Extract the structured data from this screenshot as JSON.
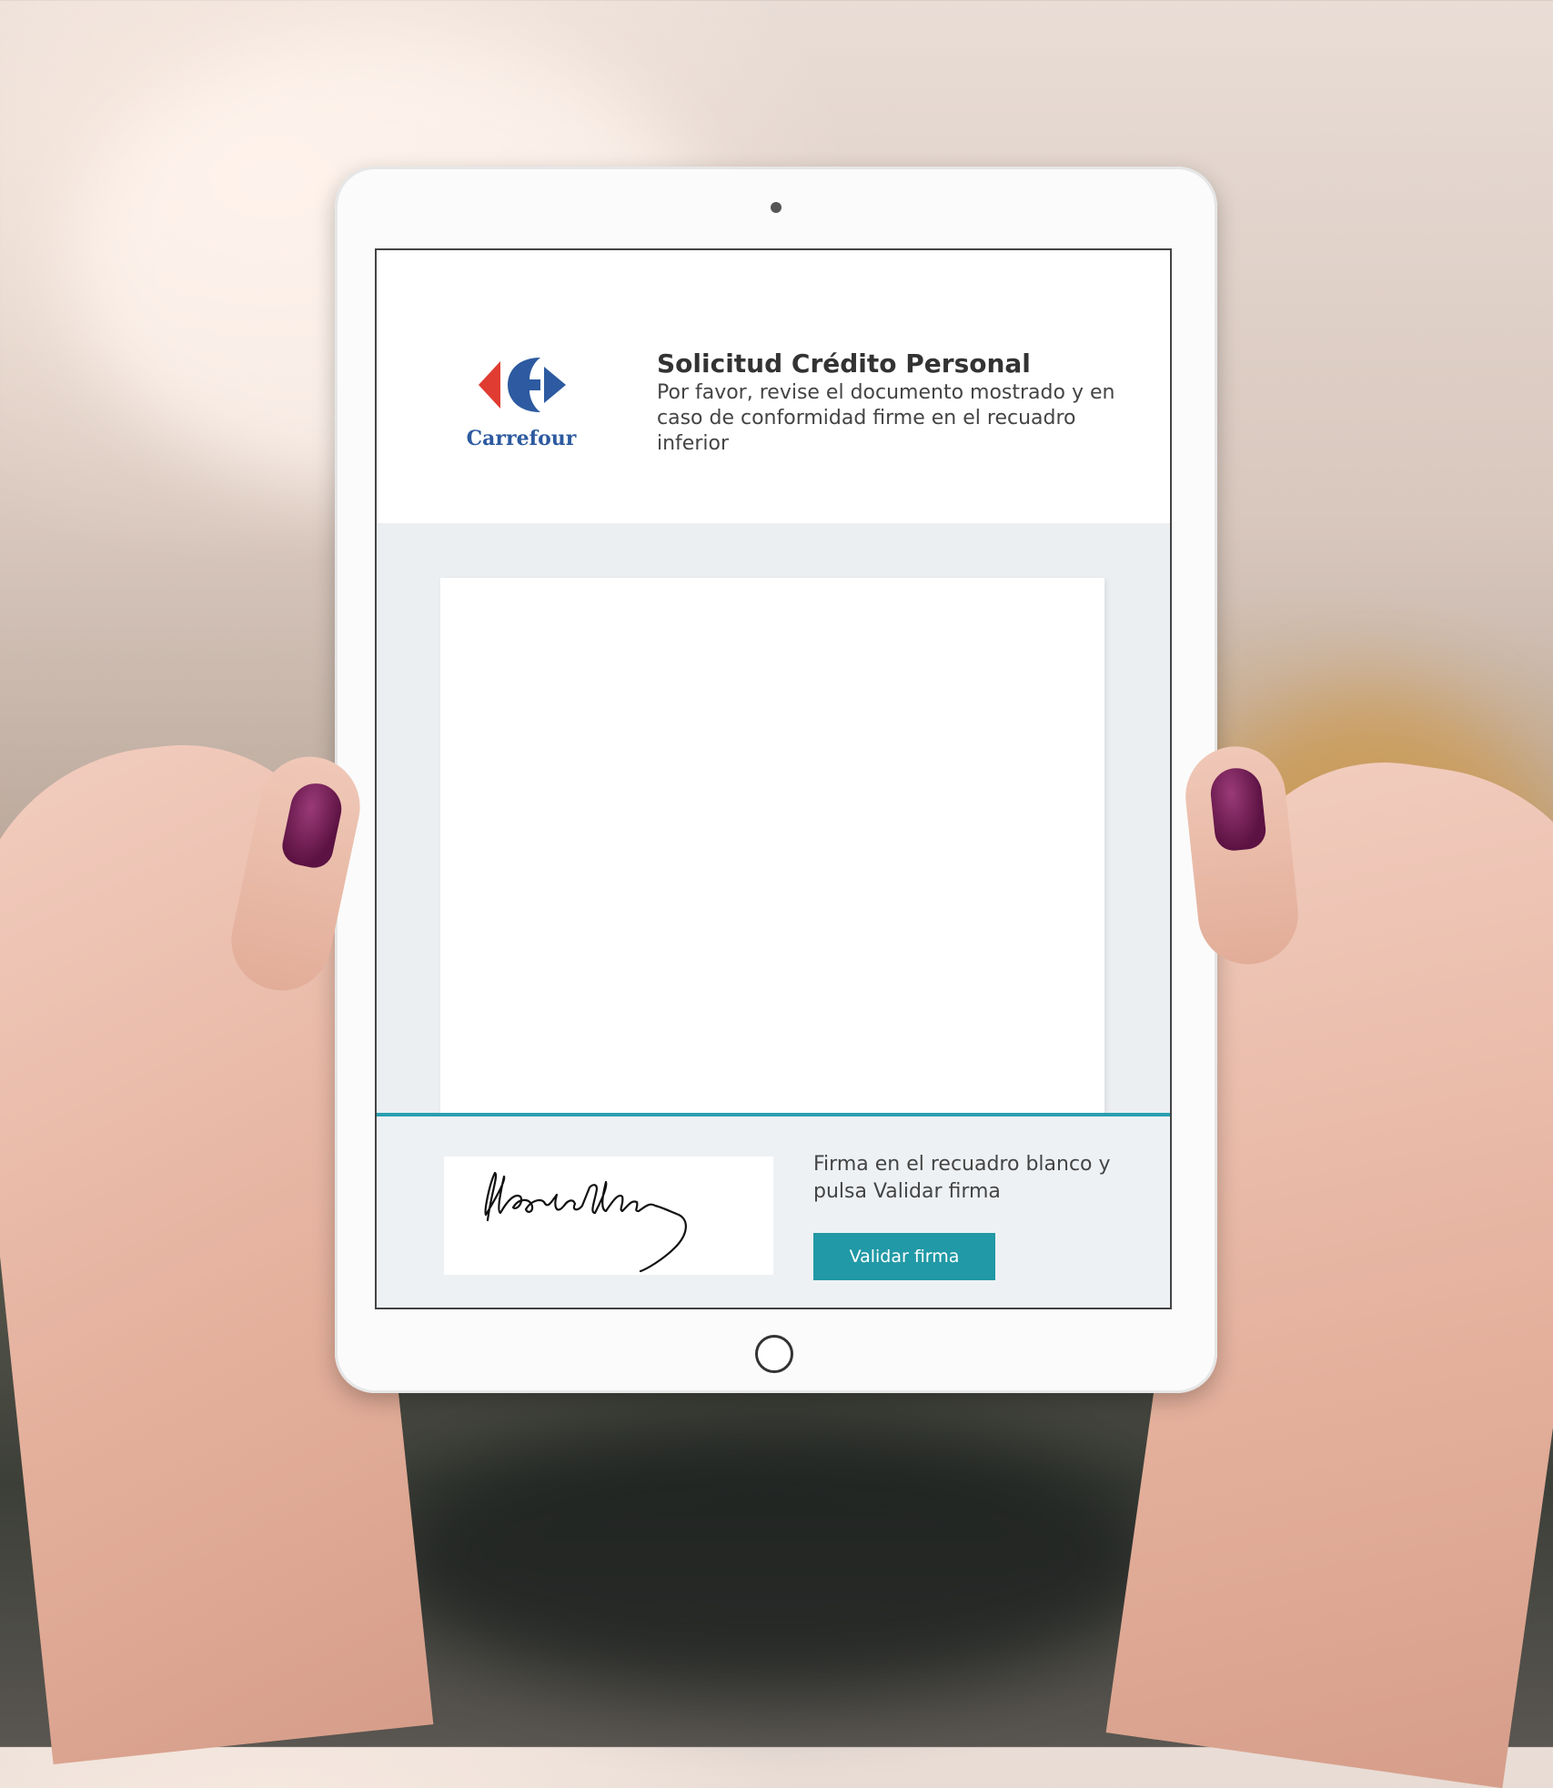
{
  "app": {
    "brand": "Carrefour",
    "title": "Solicitud Crédito Personal",
    "subtitle": "Por favor, revise el documento mostrado y en caso de conformidad firme en el recuadro inferior"
  },
  "signature": {
    "instructions": "Firma en el recuadro blanco y pulsa Validar firma",
    "validate_label": "Validar firma",
    "signed_name": "Woodrow Wilson"
  },
  "colors": {
    "accent": "#2199a6",
    "brand_blue": "#2d5aa0",
    "brand_red": "#e03c31"
  },
  "icons": [
    "carrefour-logo-icon",
    "camera-icon",
    "home-button-icon"
  ]
}
